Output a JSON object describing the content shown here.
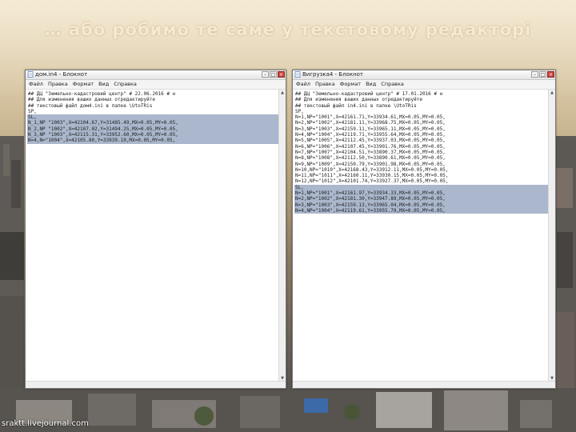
{
  "slide": {
    "title": "… або робимо те саме у текстовому редакторі",
    "watermark": "sraktt.livejournal.com"
  },
  "windows": [
    {
      "id": "left",
      "title": "дом.in4 - Блокнот",
      "menu": [
        "Файл",
        "Правка",
        "Формат",
        "Вид",
        "Справка"
      ],
      "lines": [
        {
          "text": "## ДЦ \"Земельно-кадастровий центр\" # 22.06.2016 # н",
          "selected": false
        },
        {
          "text": "## Для изменения ваших данных отредактируйте",
          "selected": false
        },
        {
          "text": "## текстовый файл дом4.ini в папке \\UtoTRis",
          "selected": false
        },
        {
          "text": "SP,",
          "selected": false
        },
        {
          "text": "SL,",
          "selected": true
        },
        {
          "text": "N_1,NP \"1003\",X=42104.67,Y=31485.49,MX=0.05,MY=0.05,",
          "selected": true
        },
        {
          "text": "N_2,NP \"1002\",X=42107.02,Y=31494.25,MX=0.05,MY=0.05,",
          "selected": true
        },
        {
          "text": "N_3,NP \"1003\",X=42115.31,Y=33952.60,MX=0.05,MY=0.05,",
          "selected": true
        },
        {
          "text": "N=4,N=\"1004\",X=42105.80,Y=33939.10,MX=0.05,MY=0.05,",
          "selected": true
        }
      ]
    },
    {
      "id": "right",
      "title": "Вигрузка4 - Блокнот",
      "menu": [
        "Файл",
        "Правка",
        "Формат",
        "Вид",
        "Справка"
      ],
      "lines": [
        {
          "text": "## ДЦ \"Земельно-кадастровий центр\" # 17.01.2016 # н",
          "selected": false
        },
        {
          "text": "## Для изменения ваших данных отредактируйте",
          "selected": false
        },
        {
          "text": "## текстовый файл in4.ini в папке \\UtoTRis",
          "selected": false
        },
        {
          "text": "SP,",
          "selected": false
        },
        {
          "text": "N=1,NP=\"1001\",X=42161.71,Y=33934.61,MX=0.05,MY=0.05,",
          "selected": false
        },
        {
          "text": "N=2,NP=\"1002\",X=42181.11,Y=33968.75,MX=0.05,MY=0.05,",
          "selected": false
        },
        {
          "text": "N=3,NP=\"1003\",X=42159.11,Y=33965.11,MX=0.05,MY=0.05,",
          "selected": false
        },
        {
          "text": "N=4,NP=\"1004\",X=42119.71,Y=33955.64,MX=0.05,MY=0.05,",
          "selected": false
        },
        {
          "text": "N=5,NP=\"1005\",X=42112.45,Y=33937.03,MX=0.05,MY=0.05,",
          "selected": false
        },
        {
          "text": "N=6,NP=\"1006\",X=42107.45,Y=33901.76,MX=0.05,MY=0.05,",
          "selected": false
        },
        {
          "text": "N=7,NP=\"1007\",X=42104.51,Y=33890.37,MX=0.05,MY=0.05,",
          "selected": false
        },
        {
          "text": "N=8,NP=\"1008\",X=42112.50,Y=33890.61,MX=0.05,MY=0.05,",
          "selected": false
        },
        {
          "text": "N=9,NP=\"1009\",X=42150.79,Y=33901.98,MX=0.05,MY=0.05,",
          "selected": false
        },
        {
          "text": "N=10,NP=\"1010\",X=42168.43,Y=33912.11,MX=0.05,MY=0.05,",
          "selected": false
        },
        {
          "text": "N=11,NP=\"1011\",X=42160.11,Y=33930.15,MX=0.05,MY=0.05,",
          "selected": false
        },
        {
          "text": "N=12,NP=\"1012\",X=42101.74,Y=33927.37,MX=0.05,MY=0.05,",
          "selected": false
        },
        {
          "text": "SL,",
          "selected": true
        },
        {
          "text": "N=1,NP=\"1001\",X=42161.97,Y=33934.33,MX=0.05,MY=0.05,",
          "selected": true
        },
        {
          "text": "N=2,NP=\"1002\",X=42181.30,Y=33947.89,MX=0.05,MY=0.05,",
          "selected": true
        },
        {
          "text": "N=3,NP=\"1003\",X=42159.13,Y=33965.04,MX=0.05,MY=0.05,",
          "selected": true
        },
        {
          "text": "N=4,NP=\"1004\",X=42119.61,Y=33955.79,MX=0.05,MY=0.05,",
          "selected": true
        }
      ]
    }
  ],
  "colors": {
    "selection": "#aab7cc",
    "title_text": "#f6e9cf"
  }
}
